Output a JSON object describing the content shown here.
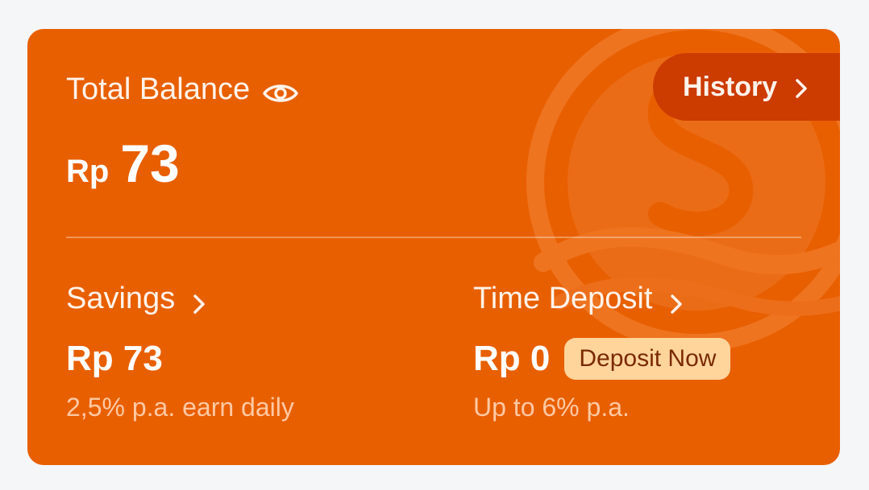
{
  "balance": {
    "label": "Total Balance",
    "currency": "Rp",
    "amount": "73"
  },
  "history": {
    "label": "History"
  },
  "savings": {
    "title": "Savings",
    "amount": "Rp 73",
    "rate": "2,5% p.a. earn daily"
  },
  "time_deposit": {
    "title": "Time Deposit",
    "amount": "Rp 0",
    "cta": "Deposit Now",
    "rate": "Up to 6% p.a."
  },
  "icons": {
    "visibility": "eye-icon",
    "chevron": "chevron-right-icon",
    "watermark": "coin-logo-icon"
  },
  "colors": {
    "card": "#e85f00",
    "history_button": "#cc3b00",
    "deposit_badge": "#ffd59c",
    "deposit_badge_text": "#7a2a00",
    "subtext": "#ffc9a3"
  }
}
